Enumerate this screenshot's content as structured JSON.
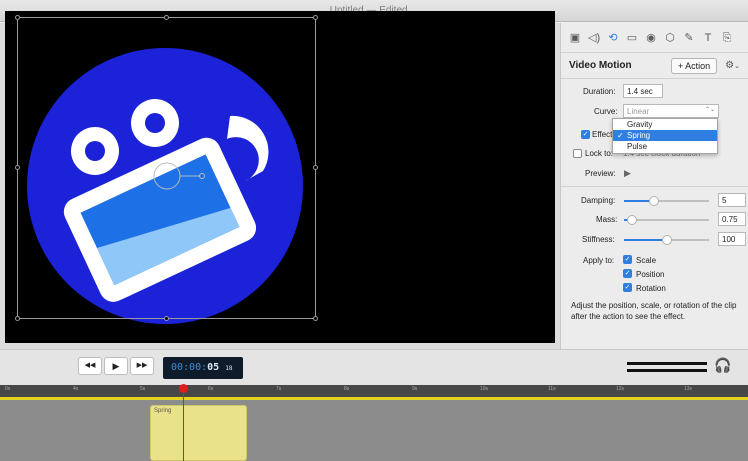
{
  "window": {
    "title": "Untitled — Edited",
    "title_chevron": "⌄"
  },
  "inspector": {
    "toolbar_icons": [
      {
        "name": "video-icon",
        "glyph": "▣",
        "active": false
      },
      {
        "name": "audio-icon",
        "glyph": "◁)",
        "active": false
      },
      {
        "name": "motion-icon",
        "glyph": "⟲",
        "active": true
      },
      {
        "name": "screen-icon",
        "glyph": "▭",
        "active": false
      },
      {
        "name": "record-icon",
        "glyph": "◉",
        "active": false
      },
      {
        "name": "shapes-icon",
        "glyph": "⬡",
        "active": false
      },
      {
        "name": "pen-icon",
        "glyph": "✎",
        "active": false
      },
      {
        "name": "text-icon",
        "glyph": "T",
        "active": false
      },
      {
        "name": "stamp-icon",
        "glyph": "⎘",
        "active": false
      }
    ],
    "title": "Video Motion",
    "action_button": "+ Action",
    "gear": "⚙",
    "gear_chevron": "⌄",
    "duration_label": "Duration:",
    "duration_value": "1.4 sec",
    "curve_label": "Curve:",
    "curve_value": "Linear",
    "curve_chevron": "⌃⌄",
    "effect_label": "Effect",
    "lock_label": "Lock to:",
    "lock_value": "1.4 sec clock duration",
    "preview_label": "Preview:",
    "preview_icon": "▶",
    "sliders": [
      {
        "label": "Damping:",
        "value": "5",
        "fraction": 0.35
      },
      {
        "label": "Mass:",
        "value": "0.75",
        "fraction": 0.08
      },
      {
        "label": "Stiffness:",
        "value": "100",
        "fraction": 0.5
      }
    ],
    "apply_label": "Apply to:",
    "apply_options": [
      {
        "label": "Scale",
        "checked": true
      },
      {
        "label": "Position",
        "checked": true
      },
      {
        "label": "Rotation",
        "checked": true
      }
    ],
    "help_text": "Adjust the position, scale, or rotation of the clip after the action to see the effect."
  },
  "dropdown": {
    "options": [
      "Gravity",
      "Spring",
      "Pulse"
    ],
    "selected": "Spring",
    "check": "✓"
  },
  "controls": {
    "rewind": "◀◀",
    "play": "▶",
    "forward": "▶▶",
    "timecode_dim": "00:00:",
    "timecode_bright": "05",
    "timecode_frames": "18",
    "headphones": "🎧"
  },
  "timeline": {
    "ticks": [
      "0s",
      "4s",
      "5s",
      "6s",
      "7s",
      "8s",
      "9s",
      "10s",
      "11s",
      "12s",
      "13s"
    ],
    "clip_label": "Spring"
  },
  "colors": {
    "accent": "#2f7fe0",
    "logo_blue": "#1b22d8",
    "playhead": "#e31b1b",
    "clip": "#e9e28a"
  }
}
